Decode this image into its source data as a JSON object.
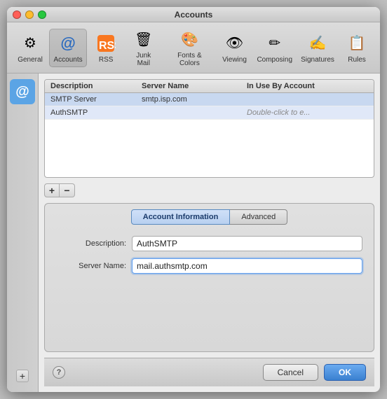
{
  "window": {
    "title": "Accounts"
  },
  "titlebar": {
    "buttons": {
      "close": "×",
      "minimize": "−",
      "maximize": "+"
    }
  },
  "toolbar": {
    "items": [
      {
        "id": "general",
        "label": "General",
        "icon": "⚙"
      },
      {
        "id": "accounts",
        "label": "Accounts",
        "icon": "@",
        "active": true
      },
      {
        "id": "rss",
        "label": "RSS",
        "icon": "📡"
      },
      {
        "id": "junk-mail",
        "label": "Junk Mail",
        "icon": "🗑"
      },
      {
        "id": "fonts-colors",
        "label": "Fonts & Colors",
        "icon": "🎨"
      },
      {
        "id": "viewing",
        "label": "Viewing",
        "icon": "👁"
      },
      {
        "id": "composing",
        "label": "Composing",
        "icon": "✏"
      },
      {
        "id": "signatures",
        "label": "Signatures",
        "icon": "✍"
      },
      {
        "id": "rules",
        "label": "Rules",
        "icon": "📋"
      }
    ]
  },
  "sidebar": {
    "items": [
      {
        "id": "account1",
        "icon": "@",
        "selected": true
      }
    ],
    "add_button": "+"
  },
  "server_table": {
    "columns": [
      "Description",
      "Server Name",
      "In Use By Account"
    ],
    "rows": [
      {
        "description": "SMTP Server",
        "server_name": "smtp.isp.com",
        "in_use": ""
      },
      {
        "description": "AuthSMTP",
        "server_name": "",
        "in_use": "Double-click to e...",
        "editing": true
      }
    ]
  },
  "table_controls": {
    "add": "+",
    "remove": "−"
  },
  "info_panel": {
    "tabs": [
      {
        "id": "account-info",
        "label": "Account Information",
        "active": true
      },
      {
        "id": "advanced",
        "label": "Advanced",
        "active": false
      }
    ],
    "fields": [
      {
        "id": "description",
        "label": "Description:",
        "value": "AuthSMTP",
        "placeholder": ""
      },
      {
        "id": "server-name",
        "label": "Server Name:",
        "value": "mail.authsmtp.com",
        "placeholder": "",
        "highlighted": true
      }
    ]
  },
  "bottom": {
    "help": "?",
    "cancel": "Cancel",
    "ok": "OK"
  },
  "outer": {
    "add": "+",
    "help": "?"
  }
}
